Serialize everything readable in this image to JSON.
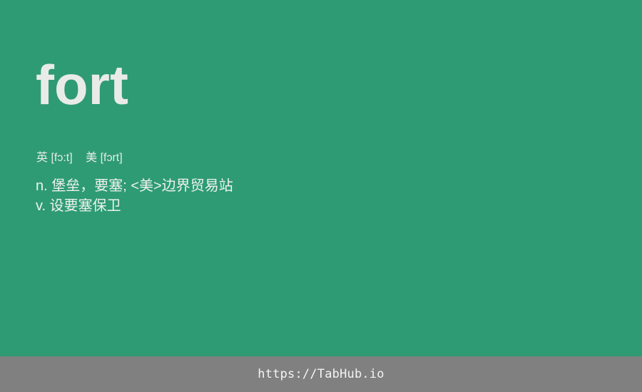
{
  "card": {
    "word": "fort",
    "phonetics": {
      "uk": "英 [fɔ:t]",
      "us": "美 [fɔrt]"
    },
    "definitions": [
      "n. 堡垒，要塞; <美>边界贸易站",
      "v. 设要塞保卫"
    ],
    "background_color": "#2e9b75"
  },
  "footer": {
    "link_text": "https://TabHub.io",
    "background_color": "#808080"
  }
}
